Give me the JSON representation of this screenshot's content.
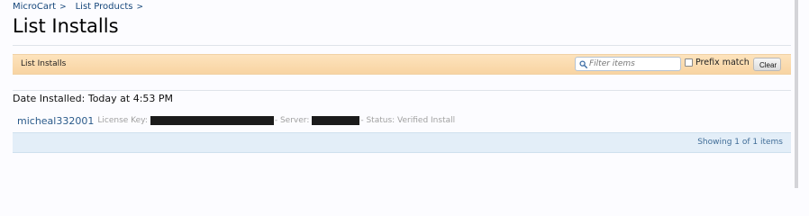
{
  "breadcrumb": {
    "items": [
      {
        "label": "MicroCart",
        "sep": ">"
      },
      {
        "label": "List Products",
        "sep": ">"
      }
    ]
  },
  "page": {
    "title": "List Installs"
  },
  "list_bar": {
    "label": "List Installs",
    "filter_placeholder": "Filter items",
    "filter_value": "",
    "prefix_match_label": "Prefix match",
    "prefix_match_checked": false,
    "clear_label": "Clear"
  },
  "group": {
    "heading": "Date Installed: Today at 4:53 PM"
  },
  "installs": [
    {
      "username": "micheal332001",
      "license_key_label": "License Key:",
      "server_label": "- Server:",
      "status_label": "- Status: Verified Install"
    }
  ],
  "footer": {
    "showing_text": "Showing 1 of 1 items"
  },
  "icons": {
    "search": "search-icon"
  },
  "colors": {
    "bar_bg": "#fde3bd",
    "footer_bg": "#e3eef8",
    "link": "#15467a",
    "redacted": "#1b1b1b"
  }
}
